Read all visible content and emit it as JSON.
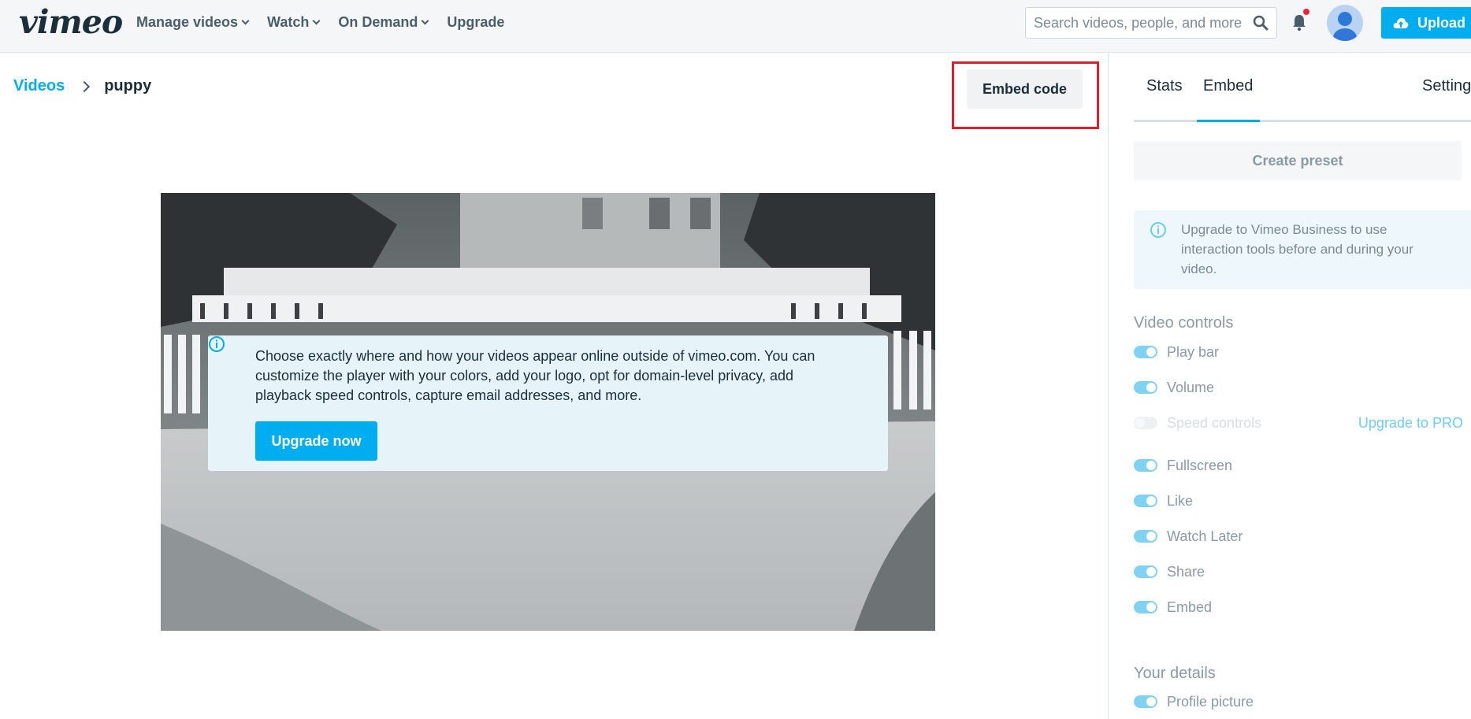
{
  "nav": {
    "logo": "vimeo",
    "items": [
      "Manage videos",
      "Watch",
      "On Demand",
      "Upgrade"
    ],
    "search_placeholder": "Search videos, people, and more",
    "upload_label": "Upload"
  },
  "breadcrumb": {
    "parent": "Videos",
    "current": "puppy"
  },
  "embed_code_label": "Embed code",
  "video_notice": {
    "text": "Choose exactly where and how your videos appear online outside of vimeo.com. You can customize the player with your colors, add your logo, opt for domain-level privacy, add playback speed controls, capture email addresses, and more.",
    "button": "Upgrade now"
  },
  "panel": {
    "tabs": [
      "Stats",
      "Embed",
      "Settings"
    ],
    "active_tab": "Embed",
    "create_preset": "Create preset",
    "info": "Upgrade to Vimeo Business to use interaction tools before and during your video.",
    "video_controls_title": "Video controls",
    "controls": [
      {
        "label": "Play bar",
        "on": true
      },
      {
        "label": "Volume",
        "on": true
      },
      {
        "label": "Speed controls",
        "on": false,
        "locked": true
      },
      {
        "label": "Fullscreen",
        "on": true
      },
      {
        "label": "Like",
        "on": true
      },
      {
        "label": "Watch Later",
        "on": true
      },
      {
        "label": "Share",
        "on": true
      },
      {
        "label": "Embed",
        "on": true
      }
    ],
    "upgrade_pro": "Upgrade to PRO",
    "details_title": "Your details",
    "details": [
      {
        "label": "Profile picture",
        "on": true
      }
    ]
  },
  "colors": {
    "accent": "#00adef",
    "highlight": "#e01d2f"
  }
}
